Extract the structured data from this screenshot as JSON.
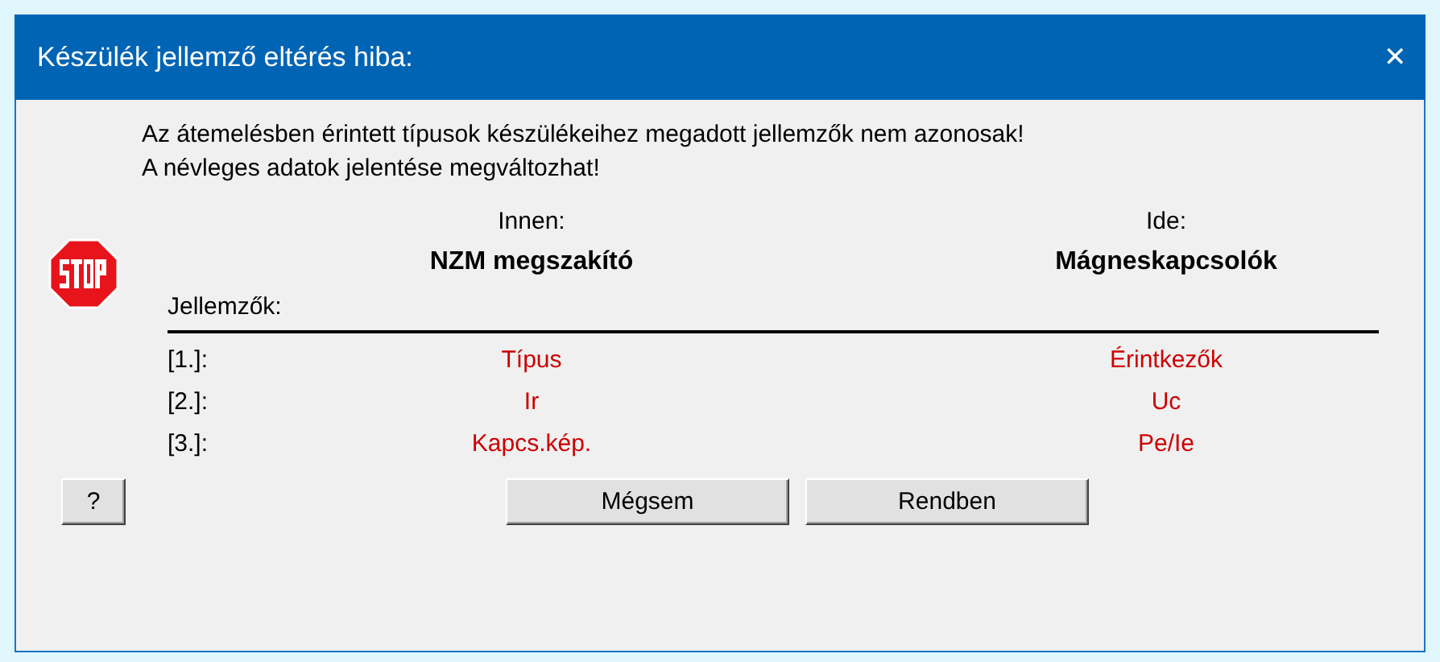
{
  "window": {
    "title": "Készülék jellemző eltérés hiba:",
    "close": "✕"
  },
  "message": [
    "Az átemelésben érintett típusok készülékeihez megadott jellemzők nem azonosak!",
    "A névleges adatok jelentése megváltozhat!"
  ],
  "from": {
    "label": "Innen:",
    "name": "NZM megszakító"
  },
  "to": {
    "label": "Ide:",
    "name": "Mágneskapcsolók"
  },
  "properties_label": "Jellemzők:",
  "rows": [
    {
      "index": "[1.]:",
      "from": "Típus",
      "to": "Érintkezők"
    },
    {
      "index": "[2.]:",
      "from": "Ir",
      "to": "Uc"
    },
    {
      "index": "[3.]:",
      "from": "Kapcs.kép.",
      "to": "Pe/Ie"
    }
  ],
  "help_button": "?",
  "buttons": [
    "Mégsem",
    "Rendben"
  ]
}
